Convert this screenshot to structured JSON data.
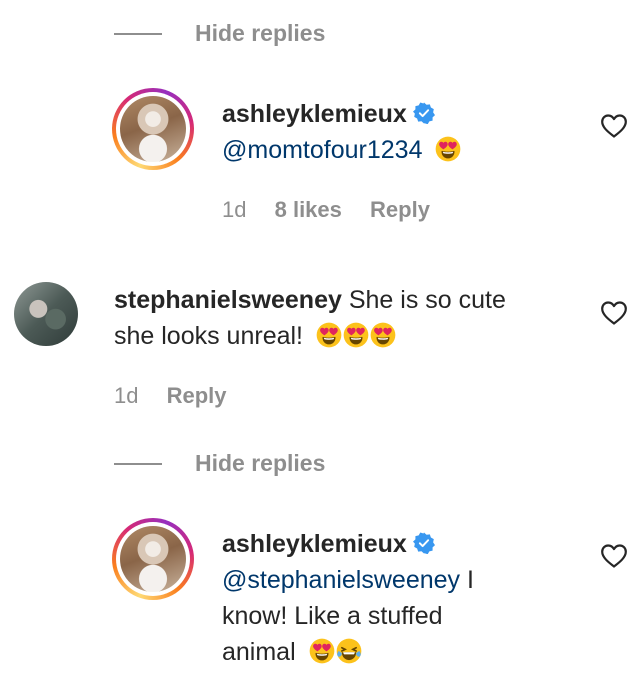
{
  "threads": [
    {
      "hide_replies": "Hide replies",
      "reply": {
        "username": "ashleyklemieux",
        "verified_icon": "verified-badge-icon",
        "mention": "@momtofour1234",
        "text": "",
        "emojis": [
          "heart-eyes-emoji"
        ],
        "time": "1d",
        "likes": "8 likes",
        "reply_label": "Reply"
      }
    }
  ],
  "comment": {
    "username": "stephanielsweeney",
    "text_line1": "She is so cute",
    "text_line2": "she looks unreal!",
    "emojis": [
      "heart-eyes-emoji",
      "heart-eyes-emoji",
      "heart-eyes-emoji"
    ],
    "time": "1d",
    "reply_label": "Reply"
  },
  "thread2": {
    "hide_replies": "Hide replies",
    "reply": {
      "username": "ashleyklemieux",
      "mention": "@stephanielsweeney",
      "text_part1": "I",
      "text_part2": "know! Like a stuffed",
      "text_part3": "animal",
      "emojis": [
        "heart-eyes-emoji",
        "laughing-tears-emoji"
      ]
    }
  },
  "icons": {
    "like": "heart-outline-icon",
    "verified": "verified-badge-icon"
  },
  "colors": {
    "text": "#262626",
    "muted": "#8e8e8e",
    "mention": "#00376b",
    "verified": "#3897f0"
  }
}
